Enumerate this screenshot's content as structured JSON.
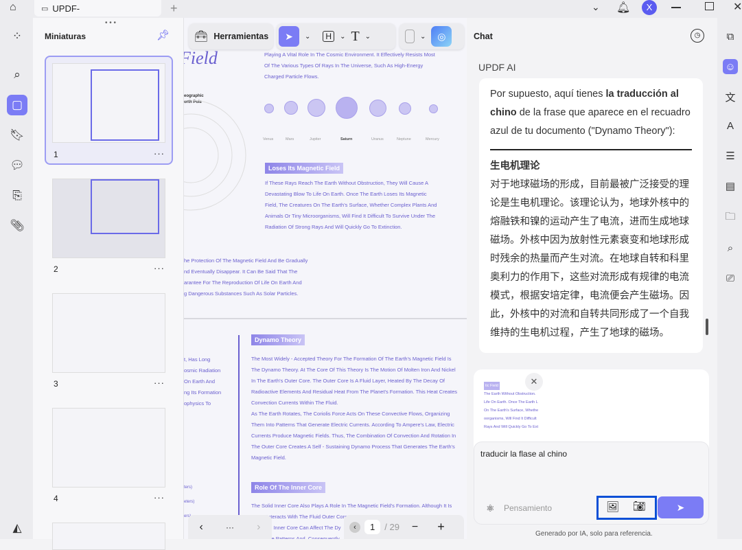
{
  "titlebar": {
    "tab_title": "UPDF-",
    "avatar_letter": "X"
  },
  "thumbnails": {
    "title": "Miniaturas",
    "pages": [
      "1",
      "2",
      "3",
      "4"
    ],
    "more": "···"
  },
  "toolbar": {
    "tools_label": "Herramientas"
  },
  "document": {
    "title_fragment": "Field",
    "intro_lines": [
      "Playing A Vital Role In The Cosmic Environment. It Effectively Resists Most",
      "Of The Various Types Of Rays In The Universe, Such As High-Energy",
      "Charged Particle Flows."
    ],
    "pole_label": [
      "eographic",
      "orth Pole"
    ],
    "planets": [
      "Venus",
      "Mars",
      "Jupiter",
      "Saturn",
      "Uranus",
      "Neptune",
      "Mercury"
    ],
    "loses_heading": "Loses Its Magnetic Field",
    "loses_lines": [
      "If These Rays Reach The Earth Without Obstruction, They Will Cause A",
      "Devastating Blow To Life On Earth. Once The Earth Loses Its Magnetic",
      "Field, The Creatures On The Earth's Surface, Whether Complex Plants And",
      "Animals Or Tiny Microorganisms, Will Find It Difficult To Survive Under The",
      "Radiation Of Strong Rays And Will Quickly Go To Extinction."
    ],
    "left_lines_1": [
      "he Protection Of The Magnetic Field And Be Gradually",
      "nd Eventually Disappear. It Can Be Said That The",
      "arantee For The Reproduction Of Life On Earth And",
      "g Dangerous Substances Such As Solar Particles."
    ],
    "left_lines_2": [
      "t, Has Long",
      "osmic Radiation",
      "On Earth And",
      "ng Its Formation",
      "ophysics To"
    ],
    "left_lines_3": [
      "ters)",
      "eters)",
      "ers)"
    ],
    "dynamo_heading": "Dynamo Theory",
    "dynamo_lines": [
      "The Most Widely - Accepted Theory For The Formation Of The Earth's Magnetic Field Is",
      "The Dynamo Theory. At The Core Of This Theory Is The Motion Of Molten Iron And Nickel",
      "In The Earth's Outer Core. The Outer Core Is A Fluid Layer, Heated By The Decay Of",
      "Radioactive Elements And Residual Heat From The Planet's Formation. This Heat Creates",
      "Convection Currents Within The Fluid.",
      "As The Earth Rotates, The Coriolis Force Acts On These Convective Flows, Organizing",
      "Them Into Patterns That Generate Electric Currents. According To Ampere's Law, Electric",
      "Currents Produce Magnetic Fields. Thus, The Combination Of Convection And Rotation In",
      "The Outer Core Creates A Self - Sustaining Dynamo Process That Generates The Earth's",
      "Magnetic Field."
    ],
    "inner_heading": "Role Of The Inner Core",
    "inner_lines": [
      "The Solid Inner Core Also Plays A Role In The Magnetic Field's Formation. Although It Is",
      "Interacts With The Fluid Outer Core",
      "he Inner Core Can Affect The Dy",
      "tive Patterns And, Consequently"
    ]
  },
  "pager": {
    "current": "1",
    "total": "/ 29",
    "more": "···"
  },
  "chat": {
    "title": "Chat",
    "sender": "UPDF AI",
    "intro_a": "Por supuesto, aquí tienes ",
    "intro_b": "la traducción al chino",
    "intro_c": " de la frase que aparece en el recuadro azul de tu documento (\"Dynamo Theory\"):",
    "zh_heading": "生电机理论",
    "zh_body": "对于地球磁场的形成，目前最被广泛接受的理论是生电机理论。该理论认为，地球外核中的熔融铁和镍的运动产生了电流，进而生成地球磁场。外核中因为放射性元素衰变和地球形成时残余的热量而产生对流。在地球自转和科里奥利力的作用下，这些对流形成有规律的电流模式，根据安培定律，电流便会产生磁场。因此，外核中的对流和自转共同形成了一个自我维持的生电机过程，产生了地球的磁场。",
    "attachment_lines": [
      "tic Field",
      "The Earth Without Obstruction.",
      "Life On Earth. Once The Earth L",
      "On The Earth's Surface, Whethe",
      "oorganisms, Will Find It Difficult",
      "Rays And Will Quickly Go To Ext"
    ],
    "input_value": "traducir la flase  al chino",
    "thinking_label": "Pensamiento",
    "disclaimer": "Generado por IA, solo para referencia."
  },
  "colors": {
    "accent": "#7b7cf5",
    "highlight_box": "#0a4fd6",
    "doc_text": "#6a5fcf"
  }
}
